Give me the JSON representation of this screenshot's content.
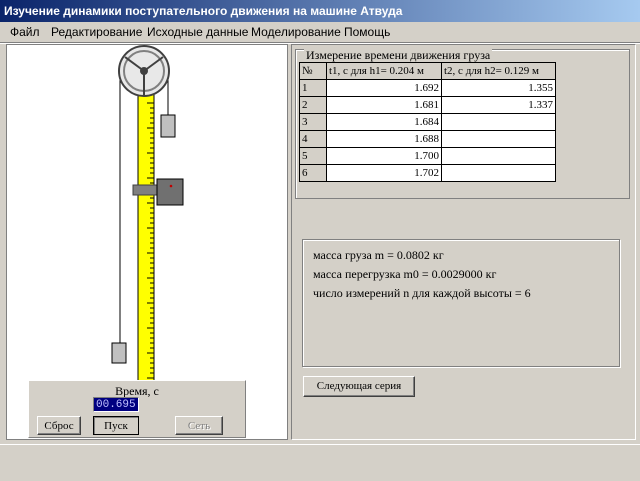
{
  "window": {
    "title": "Изучение динамики поступательного движения на машине Атвуда"
  },
  "menu": [
    "Файл",
    "Редактирование",
    "Исходные данные",
    "Моделирование",
    "Помощь"
  ],
  "measurement": {
    "group_label": "Измерение времени движения груза",
    "headers": [
      "№",
      "t1, с для h1= 0.204 м",
      "t2, с для h2= 0.129 м"
    ],
    "rows": [
      [
        "1",
        "1.692",
        "1.355"
      ],
      [
        "2",
        "1.681",
        "1.337"
      ],
      [
        "3",
        "1.684",
        ""
      ],
      [
        "4",
        "1.688",
        ""
      ],
      [
        "5",
        "1.700",
        ""
      ],
      [
        "6",
        "1.702",
        ""
      ]
    ]
  },
  "info": {
    "mass": "масса груза m = 0.0802 кг",
    "overload": "масса перегрузка m0 = 0.0029000 кг",
    "count": "число измерений n для каждой высоты = 6"
  },
  "buttons": {
    "next_series": "Следующая серия",
    "reset": "Сброс",
    "start": "Пуск",
    "net": "Сеть"
  },
  "timer": {
    "label": "Время, с",
    "value": "00.695"
  },
  "colors": {
    "column": "#ffff00",
    "title_start": "#0a246a",
    "title_end": "#a6caf0",
    "weight": "#808080"
  },
  "icons": [
    "pulley-icon"
  ]
}
